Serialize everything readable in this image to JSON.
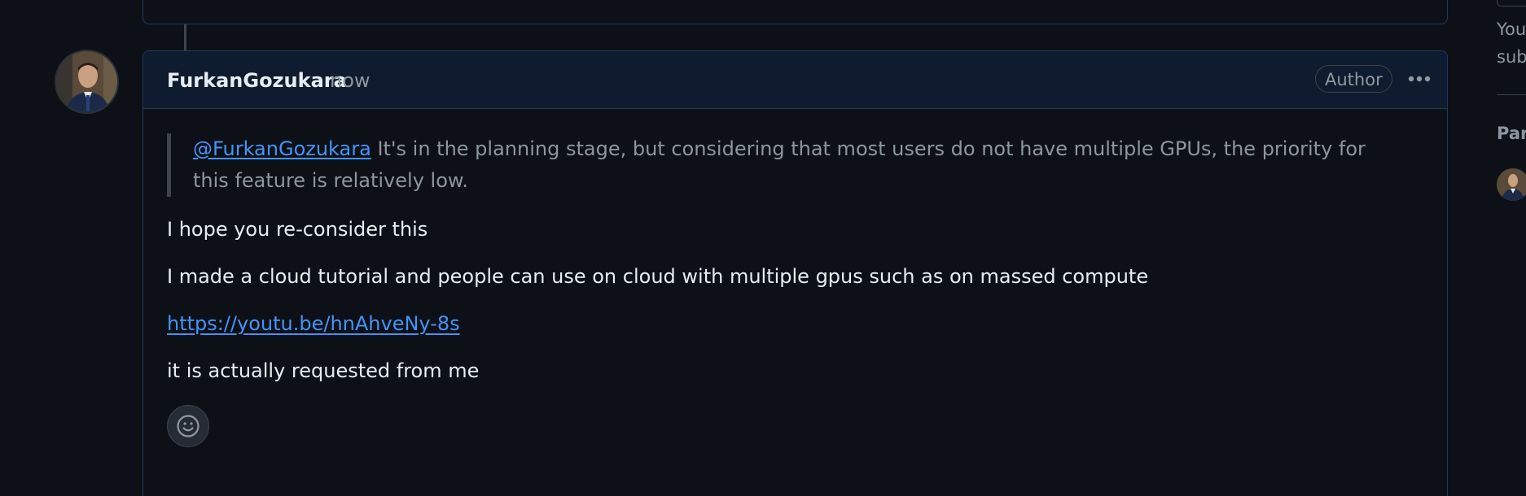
{
  "comment": {
    "author": "FurkanGozukara",
    "timestamp": "now",
    "badge": "Author",
    "quote": {
      "mention": "@FurkanGozukara",
      "text": " It's in the planning stage, but considering that most users do not have multiple GPUs, the priority for this feature is relatively low."
    },
    "paragraphs": [
      "I hope you re-consider this",
      "I made a cloud tutorial and people can use on cloud with multiple gpus such as on massed compute"
    ],
    "link": "https://youtu.be/hnAhveNy-8s",
    "closing": "it is actually requested from me"
  },
  "sidebar": {
    "text_line1": "You",
    "text_line2": "sub",
    "heading": "Par"
  },
  "icons": {
    "more": "kebab-horizontal-icon",
    "reaction": "smiley-icon"
  },
  "colors": {
    "link": "#4493f8",
    "background": "#0d1117",
    "header": "#0f1b2e",
    "border": "#1f3a5f"
  }
}
